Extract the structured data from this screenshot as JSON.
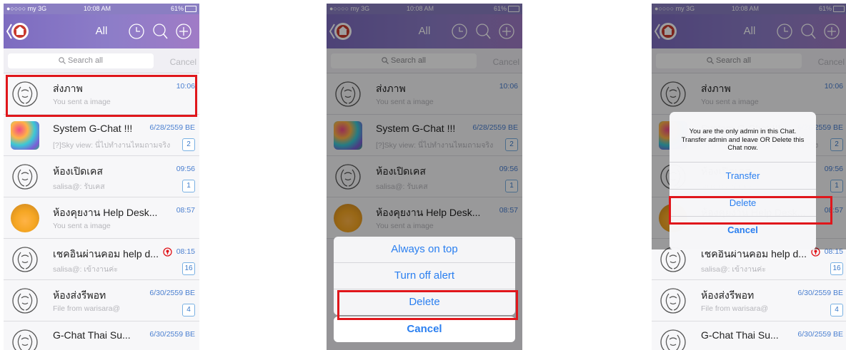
{
  "status": {
    "carrier": "●○○○○ my 3G",
    "time": "10:08 AM",
    "battery": "61%"
  },
  "nav": {
    "title": "All"
  },
  "search": {
    "placeholder": "Search all",
    "cancel": "Cancel"
  },
  "chats": [
    {
      "name": "ส่งภาพ",
      "sub": "You sent a image",
      "time": "10:06",
      "badge": ""
    },
    {
      "name": "System G-Chat !!!",
      "sub": "[?]Sky view: นี่ไปทำงานไหมถามจริง",
      "time": "6/28/2559 BE",
      "badge": "2"
    },
    {
      "name": "ห้องเปิดเคส",
      "sub": "salisa@: รับเคส",
      "time": "09:56",
      "badge": "1"
    },
    {
      "name": "ห้องคุยงาน Help Desk...",
      "sub": "You sent a image",
      "time": "08:57",
      "badge": ""
    },
    {
      "name": "เชคอินผ่านคอม help d...",
      "sub": "salisa@: เข้างานค่ะ",
      "time": "08:15",
      "badge": "16"
    },
    {
      "name": "ห้องส่งรีพอท",
      "sub": "File from warisara@",
      "time": "6/30/2559 BE",
      "badge": "4"
    },
    {
      "name": "G-Chat Thai Su...",
      "sub": "",
      "time": "6/30/2559 BE",
      "badge": ""
    }
  ],
  "action_sheet": {
    "always_on_top": "Always on top",
    "turn_off_alert": "Turn off alert",
    "delete": "Delete",
    "cancel": "Cancel"
  },
  "dialog": {
    "message": "You are the only admin in this Chat. Transfer admin and leave OR Delete this Chat now.",
    "transfer": "Transfer",
    "delete": "Delete",
    "cancel": "Cancel"
  },
  "colors": {
    "accent": "#2a7ff0",
    "highlight": "#e0161b",
    "nav_start": "#7d6cc0",
    "nav_end": "#a07bc6"
  }
}
